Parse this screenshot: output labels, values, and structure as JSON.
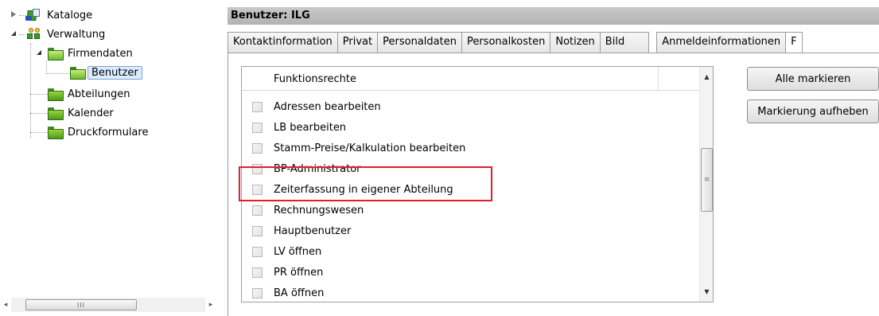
{
  "tree": {
    "items": [
      {
        "label": "Kataloge"
      },
      {
        "label": "Verwaltung"
      },
      {
        "label": "Firmendaten"
      },
      {
        "label": "Benutzer"
      },
      {
        "label": "Abteilungen"
      },
      {
        "label": "Kalender"
      },
      {
        "label": "Druckformulare"
      }
    ],
    "scrollbar_grip": "III"
  },
  "panel": {
    "title": "Benutzer: ILG",
    "tabs": [
      {
        "label": "Kontaktinformation"
      },
      {
        "label": "Privat"
      },
      {
        "label": "Personaldaten"
      },
      {
        "label": "Personalkosten"
      },
      {
        "label": "Notizen"
      },
      {
        "label": "Bild"
      },
      {
        "label": "Anmeldeinformationen"
      },
      {
        "label": "F"
      }
    ],
    "list_header": "Funktionsrechte",
    "rows": [
      {
        "label": "Adressen bearbeiten"
      },
      {
        "label": "LB bearbeiten"
      },
      {
        "label": "Stamm-Preise/Kalkulation bearbeiten"
      },
      {
        "label": "BP-Administrator"
      },
      {
        "label": "Zeiterfassung in eigener Abteilung"
      },
      {
        "label": "Rechnungswesen"
      },
      {
        "label": "Hauptbenutzer"
      },
      {
        "label": "LV öffnen"
      },
      {
        "label": "PR öffnen"
      },
      {
        "label": "BA öffnen"
      }
    ],
    "buttons": {
      "select_all": "Alle markieren",
      "deselect_all": "Markierung aufheben"
    }
  },
  "colors": {
    "highlight": "#e0202a",
    "folder_green": "#4d9a1e",
    "header_bg": "#bdbdbd"
  }
}
